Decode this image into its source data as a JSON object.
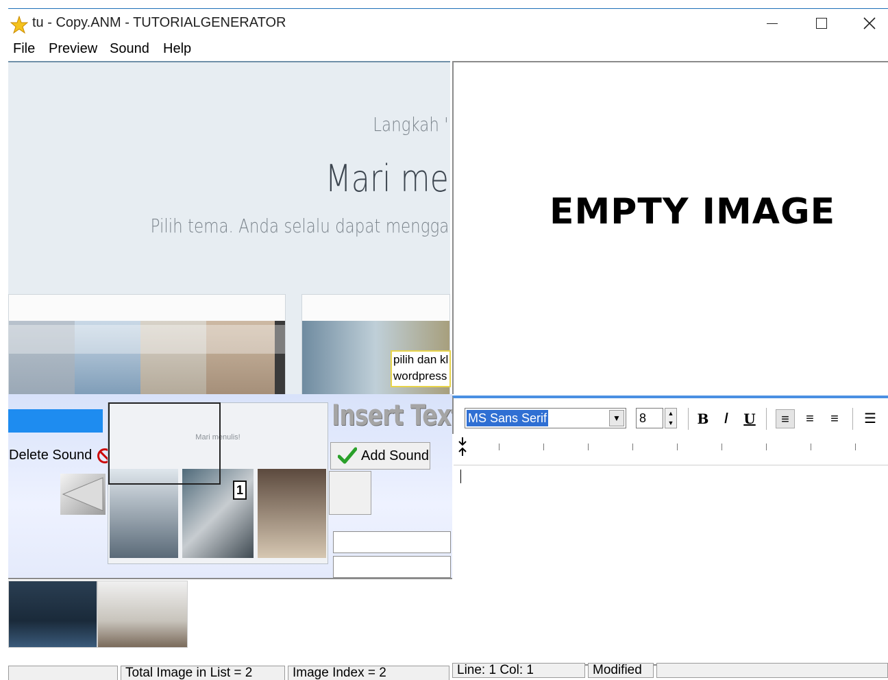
{
  "window": {
    "title": "tu - Copy.ANM - TUTORIALGENERATOR",
    "minimize": "–",
    "maximize": "☐",
    "close": "✕"
  },
  "menu": [
    "File",
    "Preview",
    "Sound",
    "Help"
  ],
  "preview": {
    "step_text": "Langkah '",
    "heading": "Mari me",
    "subtext": "Pilih tema. Anda selalu dapat mengga",
    "annotation_lines": [
      "pilih dan kl",
      "wordpress"
    ]
  },
  "empty_pane": {
    "label": "EMPTY IMAGE"
  },
  "sound_panel": {
    "delete_sound": "Delete Sound",
    "add_sound": "Add Sound",
    "insert_text": "Insert Text",
    "selection_badge": "1",
    "thumb_heading": "Mari menulis!"
  },
  "editor": {
    "font_name": "MS Sans Serif",
    "font_size": "8",
    "bold": "B",
    "italic": "/",
    "underline": "U",
    "align_left": "≡",
    "align_center": "≡",
    "align_right": "≡",
    "bullets": "☰"
  },
  "status": {
    "total_images": "Total Image in List = 2",
    "image_index": "Image Index = 2",
    "line_col": "Line:  1  Col:  1",
    "modified": "Modified"
  },
  "colors": {
    "selection_blue": "#1e8cf0",
    "font_highlight": "#2f6fd3",
    "delete_red": "#cc0a0a",
    "check_green": "#2aa02a"
  }
}
